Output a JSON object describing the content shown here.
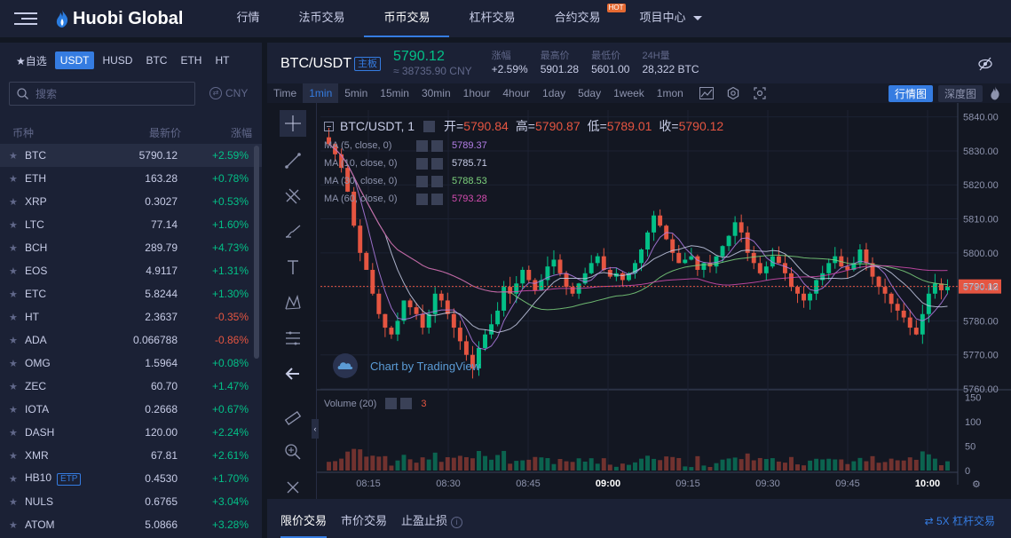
{
  "topbar": {
    "logo": "Huobi Global",
    "nav": [
      "行情",
      "法币交易",
      "币币交易",
      "杠杆交易",
      "合约交易",
      "项目中心"
    ],
    "active_nav": 2,
    "hot_badge": "HOT"
  },
  "quote_tabs": [
    "自选",
    "USDT",
    "HUSD",
    "BTC",
    "ETH",
    "HT"
  ],
  "active_quote": 1,
  "search": {
    "placeholder": "搜索",
    "currency": "CNY"
  },
  "list_headers": {
    "coin": "币种",
    "price": "最新价",
    "change": "涨幅"
  },
  "markets": [
    {
      "sym": "BTC",
      "price": "5790.12",
      "chg": "+2.59%",
      "up": true
    },
    {
      "sym": "ETH",
      "price": "163.28",
      "chg": "+0.78%",
      "up": true
    },
    {
      "sym": "XRP",
      "price": "0.3027",
      "chg": "+0.53%",
      "up": true
    },
    {
      "sym": "LTC",
      "price": "77.14",
      "chg": "+1.60%",
      "up": true
    },
    {
      "sym": "BCH",
      "price": "289.79",
      "chg": "+4.73%",
      "up": true
    },
    {
      "sym": "EOS",
      "price": "4.9117",
      "chg": "+1.31%",
      "up": true
    },
    {
      "sym": "ETC",
      "price": "5.8244",
      "chg": "+1.30%",
      "up": true
    },
    {
      "sym": "HT",
      "price": "2.3637",
      "chg": "-0.35%",
      "up": false
    },
    {
      "sym": "ADA",
      "price": "0.066788",
      "chg": "-0.86%",
      "up": false
    },
    {
      "sym": "OMG",
      "price": "1.5964",
      "chg": "+0.08%",
      "up": true
    },
    {
      "sym": "ZEC",
      "price": "60.70",
      "chg": "+1.47%",
      "up": true
    },
    {
      "sym": "IOTA",
      "price": "0.2668",
      "chg": "+0.67%",
      "up": true
    },
    {
      "sym": "DASH",
      "price": "120.00",
      "chg": "+2.24%",
      "up": true
    },
    {
      "sym": "XMR",
      "price": "67.81",
      "chg": "+2.61%",
      "up": true
    },
    {
      "sym": "HB10",
      "etp": "ETP",
      "price": "0.4530",
      "chg": "+1.70%",
      "up": true
    },
    {
      "sym": "NULS",
      "price": "0.6765",
      "chg": "+3.04%",
      "up": true
    },
    {
      "sym": "ATOM",
      "price": "5.0866",
      "chg": "+3.28%",
      "up": true
    }
  ],
  "ticker": {
    "pair": "BTC/USDT",
    "tag": "主板",
    "last": "5790.12",
    "cny": "≈ 38735.90 CNY",
    "change_label": "涨幅",
    "change": "+2.59%",
    "high_label": "最高价",
    "high": "5901.28",
    "low_label": "最低价",
    "low": "5601.00",
    "vol_label": "24H量",
    "vol": "28,322 BTC"
  },
  "timeframes": [
    "Time",
    "1min",
    "5min",
    "15min",
    "30min",
    "1hour",
    "4hour",
    "1day",
    "5day",
    "1week",
    "1mon"
  ],
  "active_tf": 1,
  "view_buttons": [
    "行情图",
    "深度图"
  ],
  "chart_header": {
    "symbol": "BTC/USDT, 1",
    "open_label": "开=",
    "open": "5790.84",
    "high_label": "高=",
    "high": "5790.87",
    "low_label": "低=",
    "low": "5789.01",
    "close_label": "收=",
    "close": "5790.12"
  },
  "ma_lines": [
    {
      "label": "MA (5, close, 0)",
      "value": "5789.37",
      "color": "#b37ee6"
    },
    {
      "label": "MA (10, close, 0)",
      "value": "5785.71",
      "color": "#c7cce6"
    },
    {
      "label": "MA (30, close, 0)",
      "value": "5788.53",
      "color": "#7ed37e"
    },
    {
      "label": "MA (60, close, 0)",
      "value": "5793.28",
      "color": "#d44cb0"
    }
  ],
  "watermark": "Chart by TradingView",
  "volume_label": "Volume (20)",
  "volume_value": "3",
  "price_ticks": [
    "5840.00",
    "5830.00",
    "5820.00",
    "5810.00",
    "5800.00",
    "5790.00",
    "5780.00",
    "5770.00",
    "5760.00"
  ],
  "current_price_tag": "5790.12",
  "volume_ticks": [
    "150",
    "100",
    "50",
    "0"
  ],
  "time_ticks": [
    "08:15",
    "08:30",
    "08:45",
    "09:00",
    "09:15",
    "09:30",
    "09:45",
    "10:00"
  ],
  "order_tabs": [
    "限价交易",
    "市价交易",
    "止盈止损"
  ],
  "leverage_link": "5X 杠杆交易",
  "colors": {
    "up": "#03c087",
    "down": "#e55541",
    "accent": "#357ce1"
  },
  "chart_data": {
    "type": "candlestick",
    "ylim": [
      5760,
      5842
    ],
    "volume_ylim": [
      0,
      160
    ],
    "x_ticks": [
      "08:15",
      "08:30",
      "08:45",
      "09:00",
      "09:15",
      "09:30",
      "09:45",
      "10:00"
    ],
    "closes": [
      5832,
      5829,
      5825,
      5818,
      5808,
      5800,
      5795,
      5788,
      5782,
      5778,
      5776,
      5780,
      5786,
      5784,
      5782,
      5778,
      5782,
      5788,
      5786,
      5782,
      5778,
      5774,
      5770,
      5766,
      5772,
      5776,
      5779,
      5783,
      5790,
      5788,
      5791,
      5795,
      5792,
      5789,
      5792,
      5796,
      5798,
      5794,
      5790,
      5788,
      5791,
      5794,
      5797,
      5799,
      5795,
      5793,
      5794,
      5792,
      5794,
      5797,
      5801,
      5806,
      5811,
      5808,
      5804,
      5800,
      5797,
      5798,
      5799,
      5795,
      5797,
      5796,
      5799,
      5802,
      5805,
      5809,
      5806,
      5800,
      5797,
      5794,
      5796,
      5799,
      5797,
      5794,
      5790,
      5788,
      5786,
      5788,
      5792,
      5794,
      5797,
      5799,
      5796,
      5795,
      5797,
      5801,
      5797,
      5793,
      5790,
      5788,
      5785,
      5783,
      5781,
      5778,
      5776,
      5782,
      5788,
      5791,
      5789,
      5790
    ]
  }
}
